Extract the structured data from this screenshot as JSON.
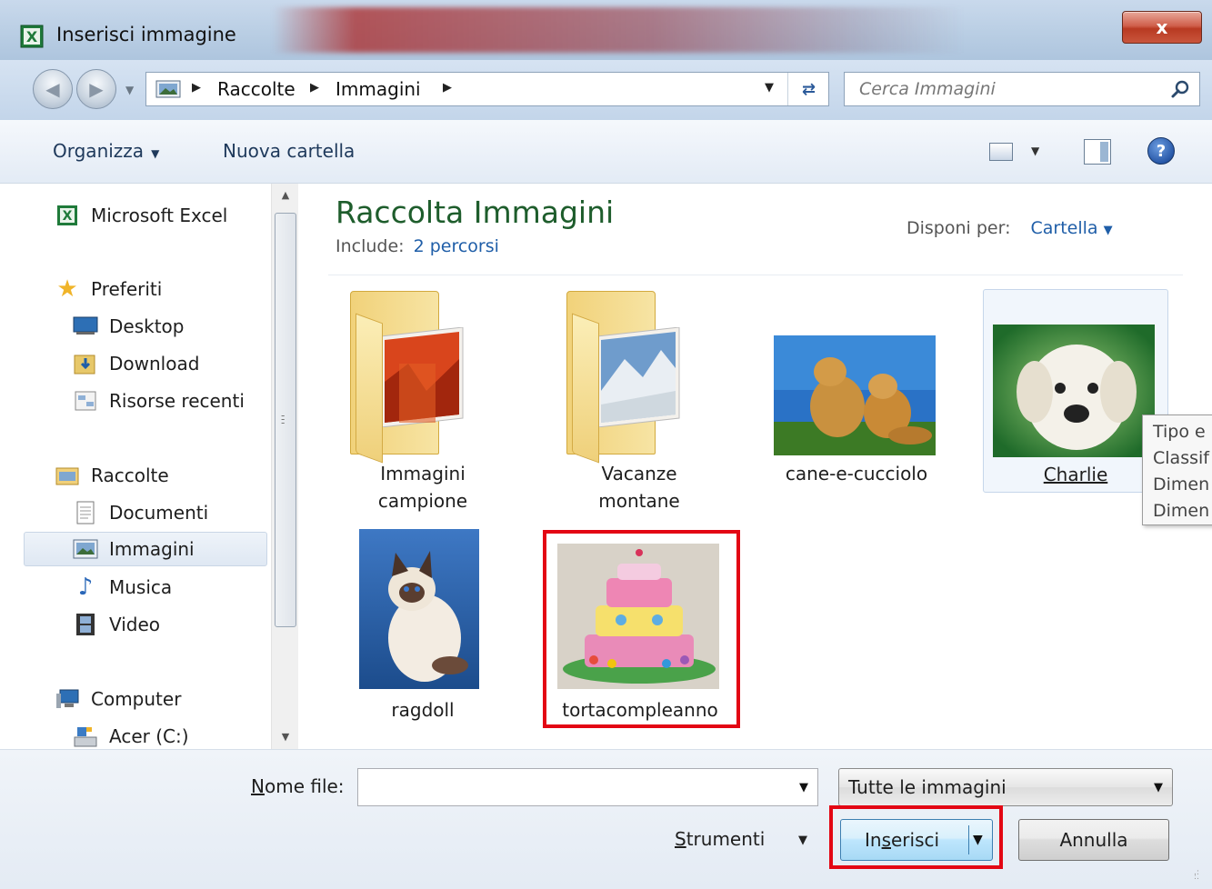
{
  "window": {
    "title": "Inserisci immagine",
    "close_label": "x"
  },
  "address": {
    "crumbs": [
      "Raccolte",
      "Immagini"
    ],
    "search_placeholder": "Cerca Immagini"
  },
  "toolbar": {
    "organize_label": "Organizza",
    "new_folder_label": "Nuova cartella"
  },
  "navpane": {
    "app": "Microsoft Excel",
    "favorites_header": "Preferiti",
    "favorites": [
      "Desktop",
      "Download",
      "Risorse recenti"
    ],
    "libraries_header": "Raccolte",
    "libraries": [
      "Documenti",
      "Immagini",
      "Musica",
      "Video"
    ],
    "computer_header": "Computer",
    "drives": [
      "Acer (C:)"
    ],
    "selected": "Immagini"
  },
  "library": {
    "title": "Raccolta Immagini",
    "include_label": "Include:",
    "include_link": "2 percorsi",
    "arrange_label": "Disponi per:",
    "arrange_value": "Cartella"
  },
  "items": [
    {
      "label_line1": "Immagini",
      "label_line2": "campione",
      "kind": "folder"
    },
    {
      "label_line1": "Vacanze",
      "label_line2": "montane",
      "kind": "folder"
    },
    {
      "label_line1": "cane-e-cucciolo",
      "kind": "image"
    },
    {
      "label_line1": "Charlie",
      "kind": "image",
      "selected": true
    },
    {
      "label_line1": "ragdoll",
      "kind": "image"
    },
    {
      "label_line1": "tortacompleanno",
      "kind": "image",
      "highlighted": true
    }
  ],
  "tooltip": {
    "lines": [
      "Tipo e",
      "Classif",
      "Dimen",
      "Dimen"
    ]
  },
  "footer": {
    "filename_label": "Nome file:",
    "filename_value": "",
    "filetype_value": "Tutte le immagini",
    "tools_label": "Strumenti",
    "insert_label": "Inserisci",
    "cancel_label": "Annulla"
  },
  "colors": {
    "highlight_box": "#e30613",
    "library_title": "#1e5d2c",
    "link": "#1f5ea8"
  }
}
